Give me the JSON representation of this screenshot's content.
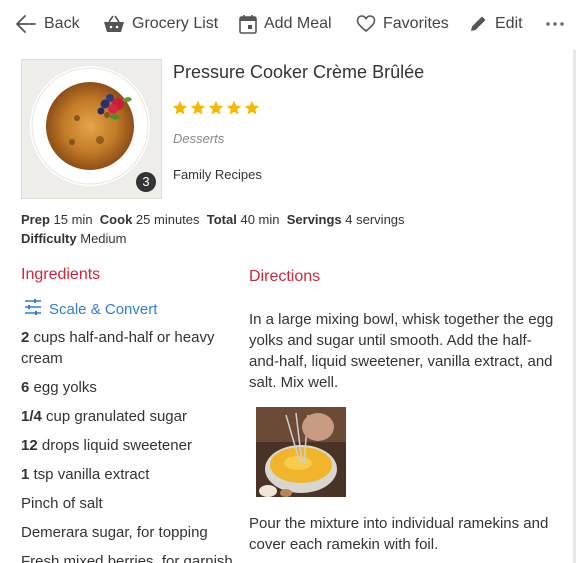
{
  "toolbar": {
    "back_label": "Back",
    "grocery_label": "Grocery List",
    "add_meal_label": "Add Meal",
    "favorites_label": "Favorites",
    "edit_label": "Edit"
  },
  "recipe": {
    "title": "Pressure Cooker Crème Brûlée",
    "rating": 5,
    "rating_max": 5,
    "category": "Desserts",
    "collection": "Family Recipes",
    "photo_count": "3",
    "prep_label": "Prep",
    "prep_value": "15 min",
    "cook_label": "Cook",
    "cook_value": "25 minutes",
    "total_label": "Total",
    "total_value": "40 min",
    "servings_label": "Servings",
    "servings_value": "4 servings",
    "difficulty_label": "Difficulty",
    "difficulty_value": "Medium"
  },
  "ingredients": {
    "heading": "Ingredients",
    "scale_label": "Scale & Convert",
    "items": [
      {
        "qty": "2",
        "text": " cups half-and-half or heavy cream"
      },
      {
        "qty": "6",
        "text": " egg yolks"
      },
      {
        "qty": "1/4",
        "text": " cup granulated sugar"
      },
      {
        "qty": "12",
        "text": " drops liquid sweetener"
      },
      {
        "qty": "1",
        "text": " tsp vanilla extract"
      },
      {
        "qty": "",
        "text": "Pinch of salt"
      },
      {
        "qty": "",
        "text": "Demerara sugar, for topping"
      },
      {
        "qty": "",
        "text": "Fresh mixed berries, for garnish"
      }
    ]
  },
  "directions": {
    "heading": "Directions",
    "steps": [
      "In a large mixing bowl, whisk together the egg yolks and sugar until smooth. Add the half-and-half, liquid sweetener, vanilla extract, and salt. Mix well.",
      "Pour the mixture into individual ramekins and cover each ramekin with foil."
    ]
  },
  "colors": {
    "accent_red": "#d0263b",
    "link_blue": "#2f7fd0",
    "star_gold": "#f5b800"
  }
}
